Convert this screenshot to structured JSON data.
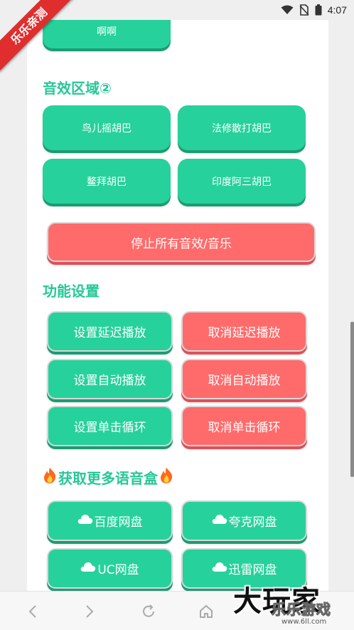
{
  "status_bar": {
    "time": "4:07"
  },
  "ribbon": {
    "text": "乐乐亲测"
  },
  "top_button": {
    "label": "啊啊"
  },
  "sound_section": {
    "title": "音效区域②",
    "buttons": [
      "鸟儿摇胡巴",
      "法修散打胡巴",
      "鳌拜胡巴",
      "印度阿三胡巴"
    ],
    "stop_label": "停止所有音效/音乐"
  },
  "function_section": {
    "title": "功能设置",
    "buttons": [
      "设置延迟播放",
      "取消延迟播放",
      "设置自动播放",
      "取消自动播放",
      "设置单击循环",
      "取消单击循环"
    ]
  },
  "more_section": {
    "title": "获取更多语音盒",
    "buttons": [
      "百度网盘",
      "夸克网盘",
      "UC网盘",
      "迅雷网盘"
    ]
  },
  "watermark": {
    "main": "大玩家",
    "sub": "乐乐游戏",
    "url": "www.6ll.com"
  },
  "colors": {
    "accent": "#27d19b",
    "danger": "#ff6b6b",
    "title": "#27c797"
  }
}
